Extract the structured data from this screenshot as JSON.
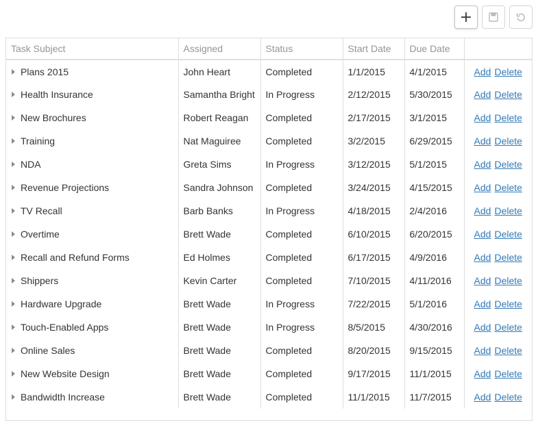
{
  "toolbar": {
    "add_icon": "plus-icon",
    "save_icon": "save-icon",
    "revert_icon": "undo-icon"
  },
  "columns": [
    "Task Subject",
    "Assigned",
    "Status",
    "Start Date",
    "Due Date",
    ""
  ],
  "rows": [
    {
      "subject": "Plans 2015",
      "assigned": "John Heart",
      "status": "Completed",
      "start": "1/1/2015",
      "due": "4/1/2015",
      "add": "Add",
      "delete": "Delete"
    },
    {
      "subject": "Health Insurance",
      "assigned": "Samantha Bright",
      "status": "In Progress",
      "start": "2/12/2015",
      "due": "5/30/2015",
      "add": "Add",
      "delete": "Delete"
    },
    {
      "subject": "New Brochures",
      "assigned": "Robert Reagan",
      "status": "Completed",
      "start": "2/17/2015",
      "due": "3/1/2015",
      "add": "Add",
      "delete": "Delete"
    },
    {
      "subject": "Training",
      "assigned": "Nat Maguiree",
      "status": "Completed",
      "start": "3/2/2015",
      "due": "6/29/2015",
      "add": "Add",
      "delete": "Delete"
    },
    {
      "subject": "NDA",
      "assigned": "Greta Sims",
      "status": "In Progress",
      "start": "3/12/2015",
      "due": "5/1/2015",
      "add": "Add",
      "delete": "Delete"
    },
    {
      "subject": "Revenue Projections",
      "assigned": "Sandra Johnson",
      "status": "Completed",
      "start": "3/24/2015",
      "due": "4/15/2015",
      "add": "Add",
      "delete": "Delete"
    },
    {
      "subject": "TV Recall",
      "assigned": "Barb Banks",
      "status": "In Progress",
      "start": "4/18/2015",
      "due": "2/4/2016",
      "add": "Add",
      "delete": "Delete"
    },
    {
      "subject": "Overtime",
      "assigned": "Brett Wade",
      "status": "Completed",
      "start": "6/10/2015",
      "due": "6/20/2015",
      "add": "Add",
      "delete": "Delete"
    },
    {
      "subject": "Recall and Refund Forms",
      "assigned": "Ed Holmes",
      "status": "Completed",
      "start": "6/17/2015",
      "due": "4/9/2016",
      "add": "Add",
      "delete": "Delete"
    },
    {
      "subject": "Shippers",
      "assigned": "Kevin Carter",
      "status": "Completed",
      "start": "7/10/2015",
      "due": "4/11/2016",
      "add": "Add",
      "delete": "Delete"
    },
    {
      "subject": "Hardware Upgrade",
      "assigned": "Brett Wade",
      "status": "In Progress",
      "start": "7/22/2015",
      "due": "5/1/2016",
      "add": "Add",
      "delete": "Delete"
    },
    {
      "subject": "Touch-Enabled Apps",
      "assigned": "Brett Wade",
      "status": "In Progress",
      "start": "8/5/2015",
      "due": "4/30/2016",
      "add": "Add",
      "delete": "Delete"
    },
    {
      "subject": "Online Sales",
      "assigned": "Brett Wade",
      "status": "Completed",
      "start": "8/20/2015",
      "due": "9/15/2015",
      "add": "Add",
      "delete": "Delete"
    },
    {
      "subject": "New Website Design",
      "assigned": "Brett Wade",
      "status": "Completed",
      "start": "9/17/2015",
      "due": "11/1/2015",
      "add": "Add",
      "delete": "Delete"
    },
    {
      "subject": "Bandwidth Increase",
      "assigned": "Brett Wade",
      "status": "Completed",
      "start": "11/1/2015",
      "due": "11/7/2015",
      "add": "Add",
      "delete": "Delete"
    }
  ]
}
